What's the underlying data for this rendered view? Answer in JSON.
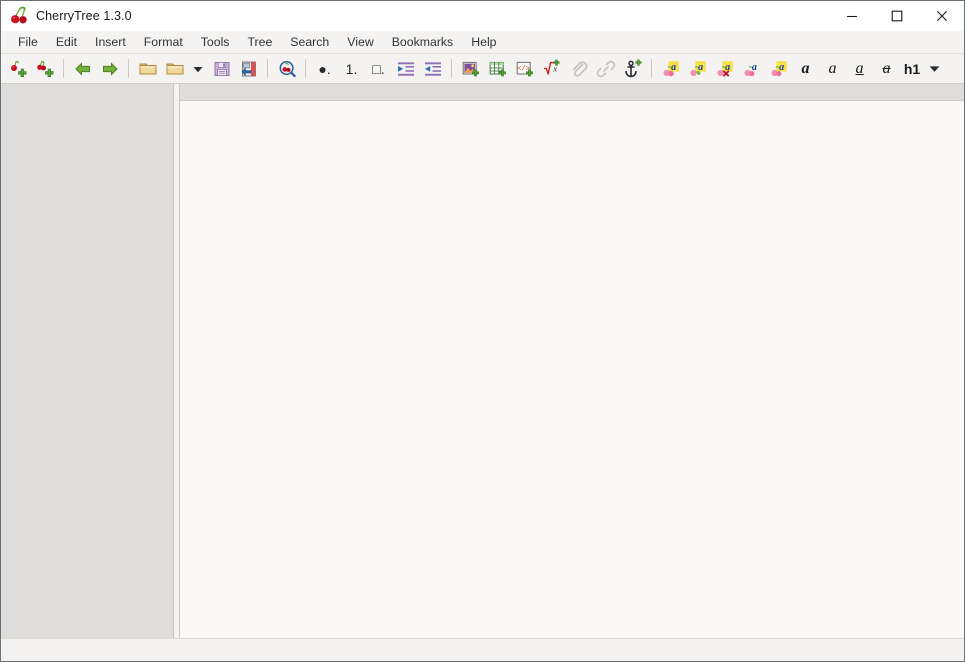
{
  "window": {
    "title": "CherryTree 1.3.0",
    "app_icon": "cherries-icon",
    "controls": {
      "minimize_label": "─",
      "maximize_label": "□",
      "close_label": "✕"
    }
  },
  "menubar": {
    "items": [
      {
        "label": "File",
        "name": "menu-file"
      },
      {
        "label": "Edit",
        "name": "menu-edit"
      },
      {
        "label": "Insert",
        "name": "menu-insert"
      },
      {
        "label": "Format",
        "name": "menu-format"
      },
      {
        "label": "Tools",
        "name": "menu-tools"
      },
      {
        "label": "Tree",
        "name": "menu-tree"
      },
      {
        "label": "Search",
        "name": "menu-search"
      },
      {
        "label": "View",
        "name": "menu-view"
      },
      {
        "label": "Bookmarks",
        "name": "menu-bookmarks"
      },
      {
        "label": "Help",
        "name": "menu-help"
      }
    ]
  },
  "toolbar": {
    "groups": [
      {
        "buttons": [
          {
            "icon": "add-node-icon",
            "tooltip": "New Node"
          },
          {
            "icon": "add-subnode-icon",
            "tooltip": "New Child Node"
          }
        ]
      },
      {
        "buttons": [
          {
            "icon": "arrow-left-icon",
            "tooltip": "Go Back"
          },
          {
            "icon": "arrow-right-icon",
            "tooltip": "Go Forward"
          }
        ]
      },
      {
        "buttons": [
          {
            "icon": "folder-open-icon",
            "tooltip": "Open File"
          },
          {
            "icon": "folder-recent-icon",
            "tooltip": "Open Recent"
          },
          {
            "icon": "chevron-down-icon",
            "tooltip": "Recent Documents"
          },
          {
            "icon": "save-icon",
            "tooltip": "Save"
          },
          {
            "icon": "save-as-icon",
            "tooltip": "Save As"
          }
        ]
      },
      {
        "buttons": [
          {
            "icon": "find-cherry-icon",
            "tooltip": "Find"
          }
        ]
      },
      {
        "buttons": [
          {
            "icon": "bulleted-list-icon",
            "tooltip": "Bulleted List",
            "glyph": "●."
          },
          {
            "icon": "numbered-list-icon",
            "tooltip": "Numbered List",
            "glyph": "1."
          },
          {
            "icon": "todo-list-icon",
            "tooltip": "To-Do List",
            "glyph": "□."
          },
          {
            "icon": "indent-increase-icon",
            "tooltip": "Increase Indent"
          },
          {
            "icon": "indent-decrease-icon",
            "tooltip": "Decrease Indent"
          }
        ]
      },
      {
        "buttons": [
          {
            "icon": "insert-image-icon",
            "tooltip": "Insert Image"
          },
          {
            "icon": "insert-table-icon",
            "tooltip": "Insert Table"
          },
          {
            "icon": "insert-codebox-icon",
            "tooltip": "Insert CodeBox"
          },
          {
            "icon": "insert-formula-icon",
            "tooltip": "Insert LaTeX Formula"
          },
          {
            "icon": "attach-file-icon",
            "tooltip": "Attach File",
            "disabled": true
          },
          {
            "icon": "insert-link-icon",
            "tooltip": "Insert/Edit Link",
            "disabled": true
          },
          {
            "icon": "insert-anchor-icon",
            "tooltip": "Insert Anchor"
          }
        ]
      },
      {
        "buttons": [
          {
            "icon": "foreground-color-icon",
            "tooltip": "Text Color Foreground"
          },
          {
            "icon": "background-color-icon",
            "tooltip": "Text Color Background"
          },
          {
            "icon": "remove-formatting-icon",
            "tooltip": "Remove Formatting"
          },
          {
            "icon": "color-picker-icon",
            "tooltip": "Pick Color"
          },
          {
            "icon": "highlight-icon",
            "tooltip": "Highlight"
          },
          {
            "icon": "bold-icon",
            "tooltip": "Bold",
            "glyph": "a"
          },
          {
            "icon": "italic-icon",
            "tooltip": "Italic",
            "glyph": "a"
          },
          {
            "icon": "underline-icon",
            "tooltip": "Underline",
            "glyph": "a"
          },
          {
            "icon": "strikethrough-icon",
            "tooltip": "Strikethrough",
            "glyph": "a"
          },
          {
            "icon": "heading-h1-icon",
            "tooltip": "Format as Heading 1",
            "glyph": "h1"
          },
          {
            "icon": "toolbar-overflow-icon",
            "tooltip": "More Tools"
          }
        ]
      }
    ]
  },
  "tree_pane": {
    "name": "node-tree",
    "nodes": []
  },
  "editor": {
    "name": "rich-text-editor",
    "content": ""
  },
  "statusbar": {
    "text": ""
  },
  "colors": {
    "titlebar_bg": "#ffffff",
    "chrome_bg": "#f4f3f1",
    "tree_bg": "#dedddb",
    "editor_bg": "#faf9f7",
    "statusbar_bg": "#f2f1ef",
    "border": "#c9c7c3",
    "window_border": "#6c7075",
    "cherry_red": "#cc0f1f",
    "leaf_green": "#6aa82f",
    "arrow_green": "#73b13a",
    "folder_tan": "#e8c98a",
    "save_purple": "#c9b6dd",
    "accent_blue": "#4a7ebb",
    "highlight_yellow": "#f7e04a",
    "cherry_pink": "#f48fb1"
  }
}
